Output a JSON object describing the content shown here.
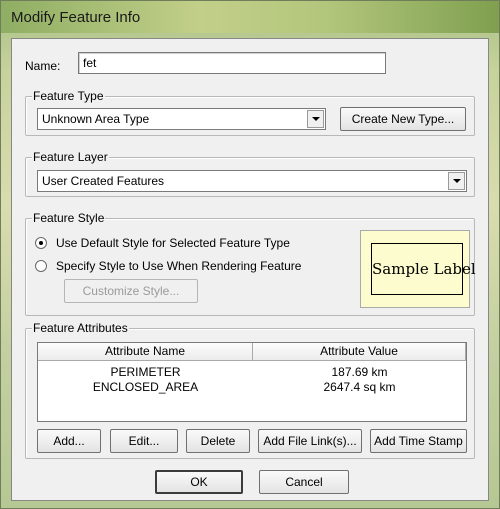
{
  "window": {
    "title": "Modify Feature Info"
  },
  "name_field": {
    "label": "Name:",
    "value": "fet"
  },
  "feature_type": {
    "group_label": "Feature Type",
    "selected": "Unknown Area Type",
    "create_button": "Create New Type..."
  },
  "feature_layer": {
    "group_label": "Feature Layer",
    "selected": "User Created Features"
  },
  "feature_style": {
    "group_label": "Feature Style",
    "option_default": "Use Default Style for Selected Feature Type",
    "option_specify": "Specify Style to Use When Rendering Feature",
    "customize_button": "Customize Style...",
    "sample_label": "Sample Label"
  },
  "feature_attributes": {
    "group_label": "Feature Attributes",
    "columns": [
      "Attribute Name",
      "Attribute Value"
    ],
    "rows": [
      {
        "name": "PERIMETER",
        "value": "187.69 km"
      },
      {
        "name": "ENCLOSED_AREA",
        "value": "2647.4 sq km"
      }
    ],
    "buttons": {
      "add": "Add...",
      "edit": "Edit...",
      "delete": "Delete",
      "add_file_link": "Add File Link(s)...",
      "add_time_stamp": "Add Time Stamp"
    }
  },
  "footer": {
    "ok": "OK",
    "cancel": "Cancel"
  }
}
